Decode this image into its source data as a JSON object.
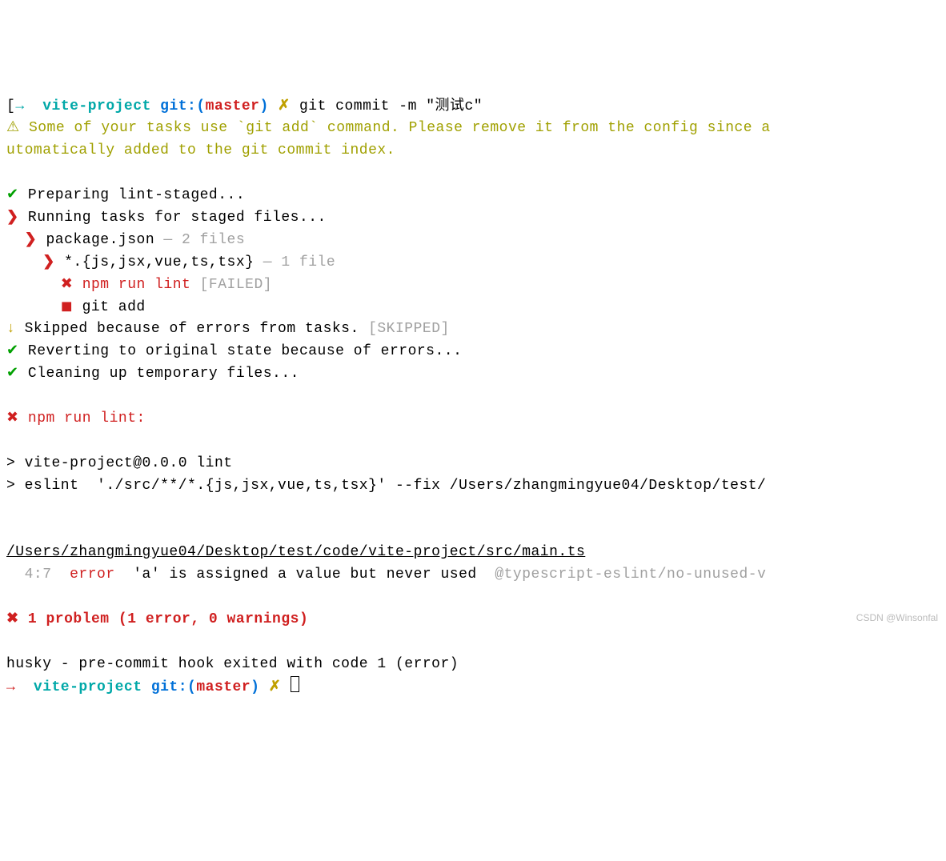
{
  "prompt1": {
    "bracket": "[",
    "arrow": "→  ",
    "project": "vite-project",
    "gitlabel": " git:(",
    "branch": "master",
    "gitclose": ")",
    "x": " ✗ ",
    "cmd": "git commit -m \"测试c\""
  },
  "warning": {
    "icon": "⚠ ",
    "text": "Some of your tasks use `git add` command. Please remove it from the config since a\nutomatically added to the git commit index."
  },
  "tasks": {
    "prep": {
      "icon": "✔ ",
      "text": "Preparing lint-staged..."
    },
    "running": {
      "icon": "❯ ",
      "text": "Running tasks for staged files..."
    },
    "pkg": {
      "icon": "  ❯ ",
      "text": "package.json",
      "meta": " — 2 files"
    },
    "glob": {
      "icon": "    ❯ ",
      "text": "*.{js,jsx,vue,ts,tsx}",
      "meta": " — 1 file"
    },
    "npm": {
      "icon": "      ✖ ",
      "text": "npm run lint",
      "meta": " [FAILED]"
    },
    "gitadd": {
      "icon": "      ◼ ",
      "text": "git add"
    },
    "skipped": {
      "icon": "↓ ",
      "text": "Skipped because of errors from tasks.",
      "meta": " [SKIPPED]"
    },
    "revert": {
      "icon": "✔ ",
      "text": "Reverting to original state because of errors..."
    },
    "clean": {
      "icon": "✔ ",
      "text": "Cleaning up temporary files..."
    }
  },
  "fail_header": {
    "icon": "✖ ",
    "text": "npm run lint:"
  },
  "script": {
    "line1": "> vite-project@0.0.0 lint",
    "line2": "> eslint  './src/**/*.{js,jsx,vue,ts,tsx}' --fix /Users/zhangmingyue04/Desktop/test/"
  },
  "eslint": {
    "file": "/Users/zhangmingyue04/Desktop/test/code/vite-project/src/main.ts",
    "loc": "  4:7  ",
    "level": "error",
    "msg": "  'a' is assigned a value but never used  ",
    "rule": "@typescript-eslint/no-unused-v"
  },
  "summary": {
    "icon": "✖ ",
    "text": "1 problem (1 error, 0 warnings)"
  },
  "husky": "husky - pre-commit hook exited with code 1 (error)",
  "prompt2": {
    "arrow": "→  ",
    "project": "vite-project",
    "gitlabel": " git:(",
    "branch": "master",
    "gitclose": ")",
    "x": " ✗ "
  },
  "watermark": "CSDN @Winsonfal"
}
